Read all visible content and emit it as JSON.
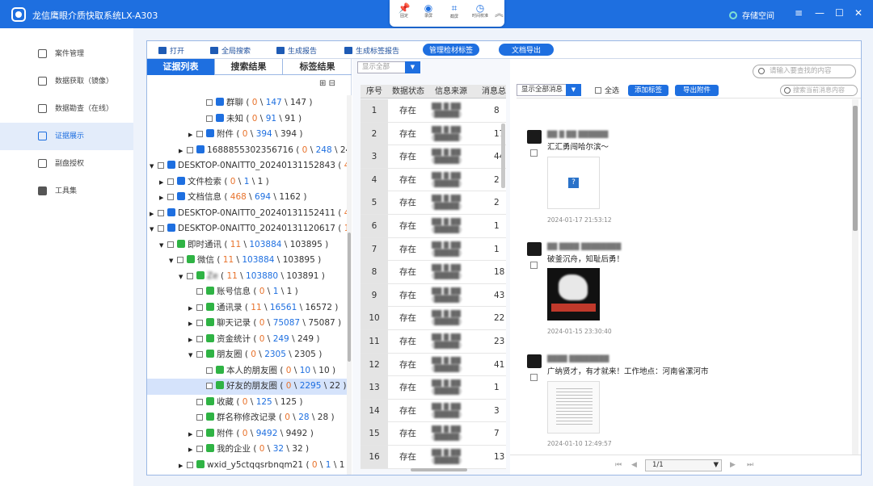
{
  "app": {
    "title": "龙信鹰眼介质快取系统LX-A303",
    "storage": "存储空间"
  },
  "window_controls": {
    "settings": "≡",
    "minimize": "—",
    "maximize": "☐",
    "close": "✕"
  },
  "top_tools": [
    {
      "label": "固定",
      "icon": "pin-icon",
      "active": true
    },
    {
      "label": "录屏",
      "icon": "record-icon"
    },
    {
      "label": "截屏",
      "icon": "crop-icon"
    },
    {
      "label": "时间校准",
      "icon": "clock-icon"
    }
  ],
  "sidebar": {
    "items": [
      {
        "label": "案件管理",
        "icon": "case-icon"
      },
      {
        "label": "数据获取（镜像）",
        "icon": "disk-image-icon"
      },
      {
        "label": "数据勘查（在线）",
        "icon": "monitor-icon"
      },
      {
        "label": "证据展示",
        "icon": "evidence-display-icon",
        "active": true
      },
      {
        "label": "副盘授权",
        "icon": "authorization-icon"
      },
      {
        "label": "工具集",
        "icon": "toolbox-icon"
      }
    ]
  },
  "toolbar": {
    "open": "打开",
    "global_search": "全局搜索",
    "gen_report": "生成报告",
    "gen_tag_report": "生成标签报告",
    "manage_tags": "管理检材标签",
    "export_doc": "文档导出"
  },
  "tabs": [
    "证据列表",
    "搜索结果",
    "标签结果"
  ],
  "tree": [
    {
      "indent": 5,
      "arrow": "",
      "icon_color": "#1e6fe0",
      "name": "群聊",
      "a": "0",
      "b": "147",
      "c": "147"
    },
    {
      "indent": 5,
      "arrow": "",
      "icon_color": "#1e6fe0",
      "name": "未知",
      "a": "0",
      "b": "91",
      "c": "91"
    },
    {
      "indent": 4,
      "arrow": "▶",
      "icon_color": "#1e6fe0",
      "name": "附件",
      "a": "0",
      "b": "394",
      "c": "394"
    },
    {
      "indent": 3,
      "arrow": "▶",
      "icon_color": "#1e6fe0",
      "name": "1688855302356716",
      "a": "0",
      "b": "248",
      "c": "24"
    },
    {
      "indent": 0,
      "arrow": "▼",
      "icon_color": "#1e6fe0",
      "name": "DESKTOP-0NAITT0_20240131152843",
      "a": "4"
    },
    {
      "indent": 1,
      "arrow": "▶",
      "icon_color": "#1e6fe0",
      "name": "文件检索",
      "a": "0",
      "b": "1",
      "c": "1"
    },
    {
      "indent": 1,
      "arrow": "▶",
      "icon_color": "#1e6fe0",
      "name": "文档信息",
      "a": "468",
      "b": "694",
      "c": "1162"
    },
    {
      "indent": 0,
      "arrow": "▶",
      "icon_color": "#1e6fe0",
      "name": "DESKTOP-0NAITT0_20240131152411",
      "a": "4"
    },
    {
      "indent": 0,
      "arrow": "▼",
      "icon_color": "#1e6fe0",
      "name": "DESKTOP-0NAITT0_20240131120617",
      "a": "1"
    },
    {
      "indent": 1,
      "arrow": "▼",
      "icon_color": "#2fb344",
      "name": "即时通讯",
      "a": "11",
      "b": "103884",
      "c": "103895"
    },
    {
      "indent": 2,
      "arrow": "▼",
      "icon_color": "#2fb344",
      "name": "微信",
      "a": "11",
      "b": "103884",
      "c": "103895"
    },
    {
      "indent": 3,
      "arrow": "▼",
      "icon_color": "#2fb344",
      "name": "Ze",
      "a": "11",
      "b": "103880",
      "c": "103891",
      "blur": true
    },
    {
      "indent": 4,
      "arrow": "",
      "icon_color": "#2fb344",
      "name": "账号信息",
      "a": "0",
      "b": "1",
      "c": "1"
    },
    {
      "indent": 4,
      "arrow": "▶",
      "icon_color": "#2fb344",
      "name": "通讯录",
      "a": "11",
      "b": "16561",
      "c": "16572"
    },
    {
      "indent": 4,
      "arrow": "▶",
      "icon_color": "#2fb344",
      "name": "聊天记录",
      "a": "0",
      "b": "75087",
      "c": "75087"
    },
    {
      "indent": 4,
      "arrow": "▶",
      "icon_color": "#2fb344",
      "name": "资金统计",
      "a": "0",
      "b": "249",
      "c": "249"
    },
    {
      "indent": 4,
      "arrow": "▼",
      "icon_color": "#2fb344",
      "name": "朋友圈",
      "a": "0",
      "b": "2305",
      "c": "2305"
    },
    {
      "indent": 5,
      "arrow": "",
      "icon_color": "#2fb344",
      "name": "本人的朋友圈",
      "a": "0",
      "b": "10",
      "c": "10"
    },
    {
      "indent": 5,
      "arrow": "",
      "icon_color": "#2fb344",
      "name": "好友的朋友圈",
      "a": "0",
      "b": "2295",
      "c": "22",
      "selected": true
    },
    {
      "indent": 4,
      "arrow": "",
      "icon_color": "#2fb344",
      "name": "收藏",
      "a": "0",
      "b": "125",
      "c": "125"
    },
    {
      "indent": 4,
      "arrow": "",
      "icon_color": "#2fb344",
      "name": "群名称修改记录",
      "a": "0",
      "b": "28",
      "c": "28"
    },
    {
      "indent": 4,
      "arrow": "▶",
      "icon_color": "#2fb344",
      "name": "附件",
      "a": "0",
      "b": "9492",
      "c": "9492"
    },
    {
      "indent": 4,
      "arrow": "▶",
      "icon_color": "#2fb344",
      "name": "我的企业",
      "a": "0",
      "b": "32",
      "c": "32"
    },
    {
      "indent": 3,
      "arrow": "▶",
      "icon_color": "#2fb344",
      "name": "wxid_y5ctqqsrbnqm21",
      "a": "0",
      "b": "1",
      "c": "1"
    }
  ],
  "middle": {
    "filter": "显示全部",
    "headers": [
      "序号",
      "数据状态",
      "信息来源",
      "消息总"
    ],
    "rows": [
      {
        "no": "1",
        "status": "存在",
        "source": "",
        "count": "8"
      },
      {
        "no": "2",
        "status": "存在",
        "source": "",
        "count": "17"
      },
      {
        "no": "3",
        "status": "存在",
        "source": "",
        "count": "44"
      },
      {
        "no": "4",
        "status": "存在",
        "source": "",
        "count": "2"
      },
      {
        "no": "5",
        "status": "存在",
        "source": "",
        "count": "2"
      },
      {
        "no": "6",
        "status": "存在",
        "source": "",
        "count": "1"
      },
      {
        "no": "7",
        "status": "存在",
        "source": "",
        "count": "1"
      },
      {
        "no": "8",
        "status": "存在",
        "source": "",
        "count": "18"
      },
      {
        "no": "9",
        "status": "存在",
        "source": "",
        "count": "43"
      },
      {
        "no": "10",
        "status": "存在",
        "source": "",
        "count": "22"
      },
      {
        "no": "11",
        "status": "存在",
        "source": "",
        "count": "23"
      },
      {
        "no": "12",
        "status": "存在",
        "source": "",
        "count": "41"
      },
      {
        "no": "13",
        "status": "存在",
        "source": "",
        "count": "1"
      },
      {
        "no": "14",
        "status": "存在",
        "source": "",
        "count": "3"
      },
      {
        "no": "15",
        "status": "存在",
        "source": "",
        "count": "7"
      },
      {
        "no": "16",
        "status": "存在",
        "source": "",
        "count": "13"
      }
    ]
  },
  "right": {
    "search_placeholder": "请输入要查找的内容",
    "filter": "显示全部消息",
    "select_all": "全选",
    "add_tag": "添加标签",
    "export_attach": "导出附件",
    "msg_search_placeholder": "搜索当前消息内容",
    "messages": [
      {
        "user": "",
        "text": "汇汇勇闯哈尔滨～",
        "time": "2024-01-17 21:53:12",
        "media": "broken-image"
      },
      {
        "user": "",
        "text": "破釜沉舟，知耻后勇！",
        "time": "2024-01-15 23:30:40",
        "media": "photo"
      },
      {
        "user": "",
        "text": "广纳贤才，有才就来！工作地点：河南省漯河市",
        "time": "2024-01-10 12:49:57",
        "media": "document"
      }
    ]
  },
  "pager": {
    "value": "1/1"
  }
}
